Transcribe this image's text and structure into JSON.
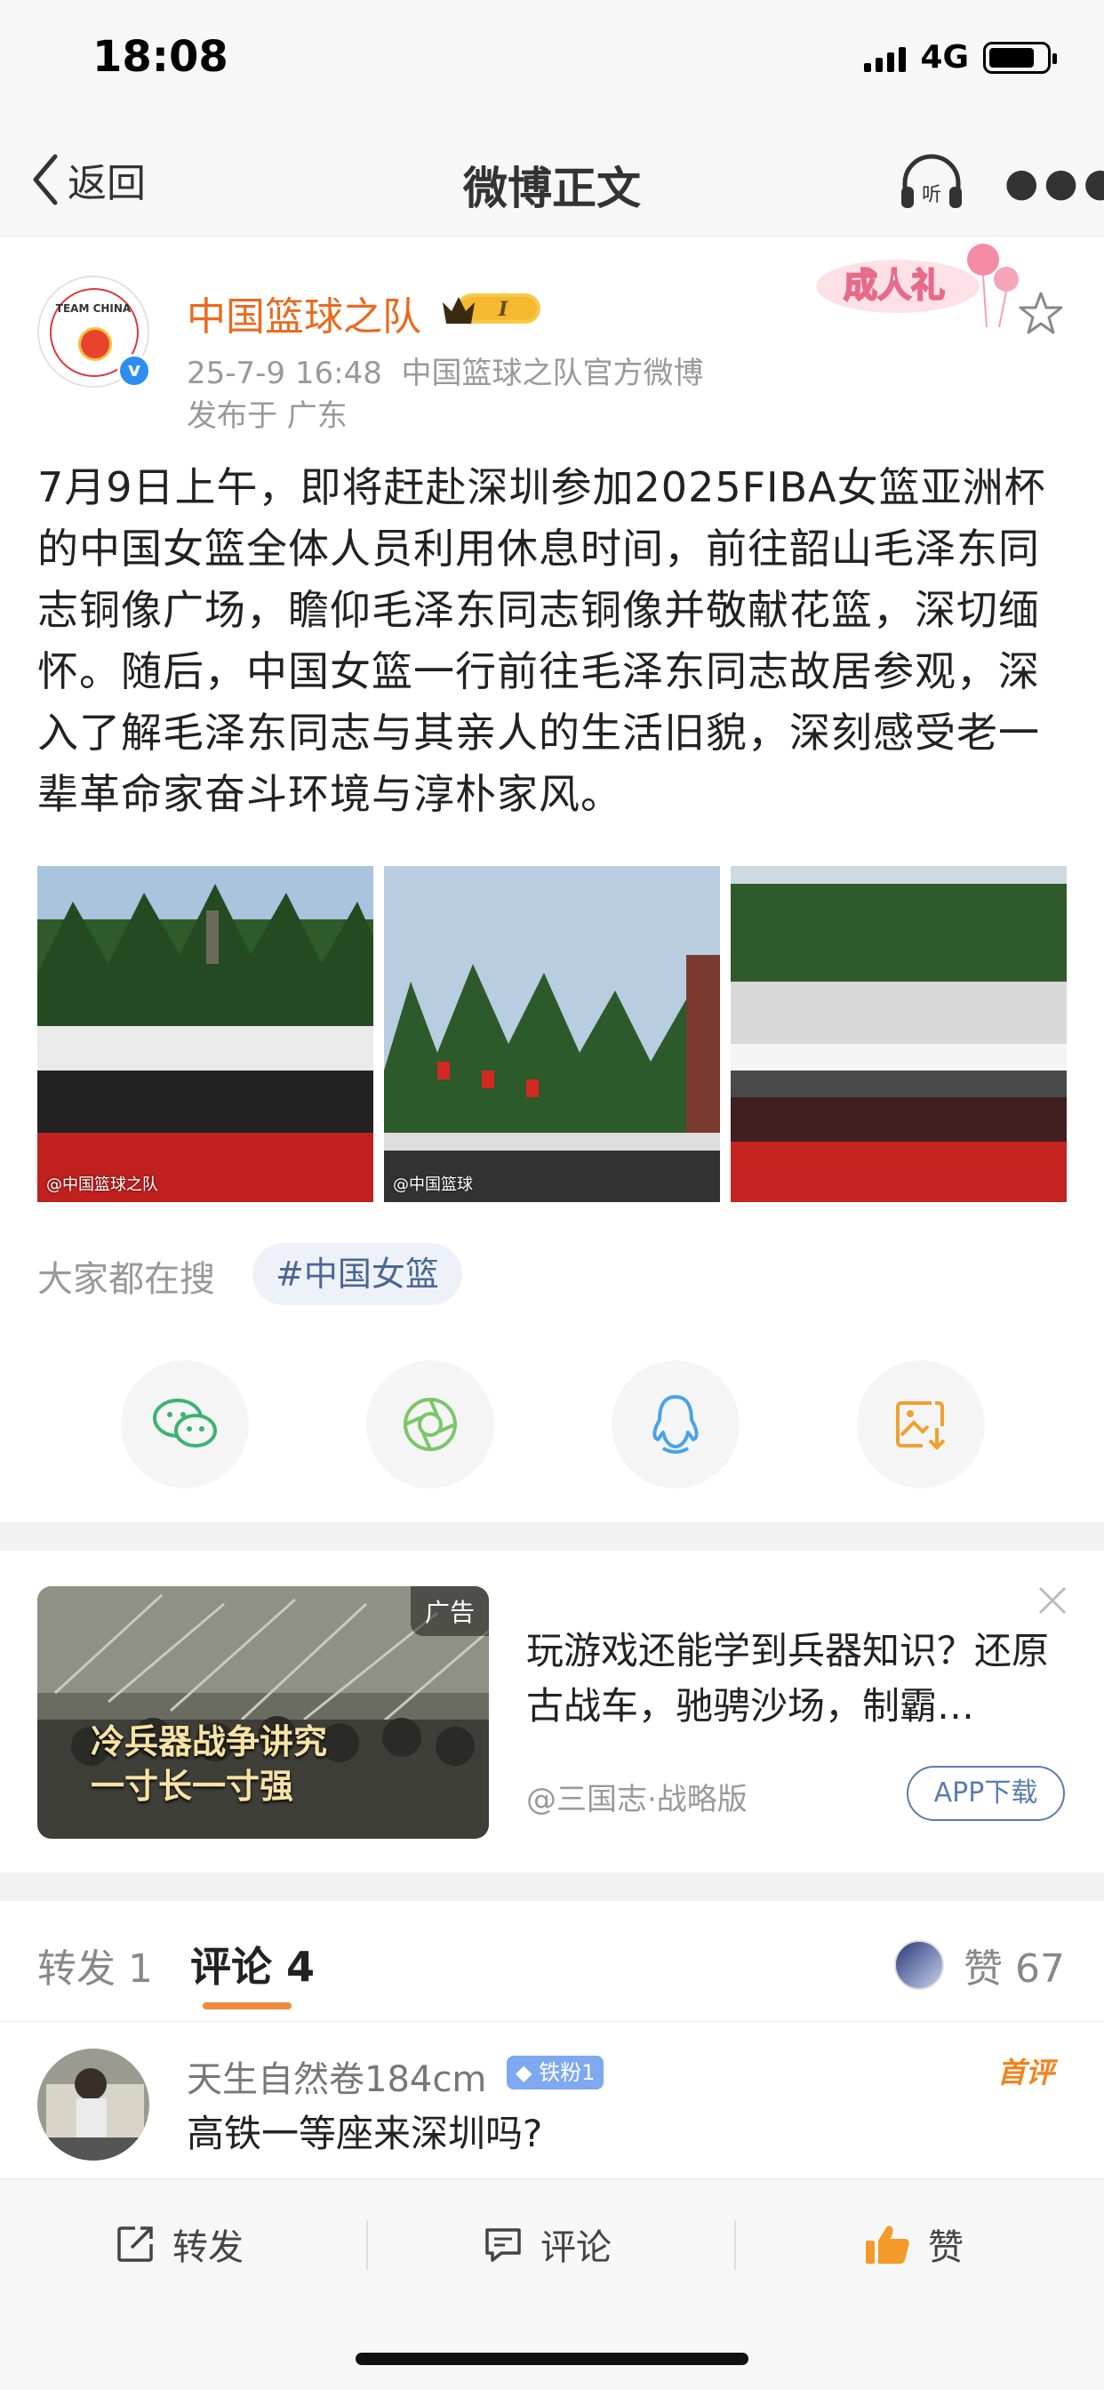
{
  "status_bar": {
    "time": "18:08",
    "network": "4G",
    "battery_level": 0.8
  },
  "nav": {
    "back_label": "返回",
    "title": "微博正文",
    "listen_label": "听"
  },
  "post": {
    "author": "中国篮球之队",
    "avatar_text": "TEAM CHINA",
    "level_badge": "I",
    "timestamp": "25-7-9 16:48",
    "source": "中国篮球之队官方微博",
    "location": "发布于 广东",
    "ceremony_badge": "成人礼",
    "text": "7月9日上午，即将赶赴深圳参加2025FIBA女篮亚洲杯的中国女篮全体人员利用休息时间，前往韶山毛泽东同志铜像广场，瞻仰毛泽东同志铜像并敬献花篮，深切缅怀。随后，中国女篮一行前往毛泽东同志故居参观，深入了解毛泽东同志与其亲人的生活旧貌，深刻感受老一辈革命家奋斗环境与淳朴家风。",
    "image_watermarks": [
      "@中国篮球之队",
      "@中国篮球",
      ""
    ]
  },
  "search": {
    "label": "大家都在搜",
    "tag": "#中国女篮"
  },
  "share_icons": [
    "wechat-icon",
    "moments-icon",
    "qq-icon",
    "save-image-icon"
  ],
  "ad": {
    "tag": "广告",
    "caption_line1": "冷兵器战争讲究",
    "caption_line2": "一寸长一寸强",
    "title": "玩游戏还能学到兵器知识？还原古战车，驰骋沙场，制霸…",
    "source": "@三国志·战略版",
    "app_button": "APP下载"
  },
  "tabs": {
    "forward": "转发 1",
    "comments": "评论 4",
    "likes": "赞 67"
  },
  "comment": {
    "name": "天生自然卷184cm",
    "fan_badge": "铁粉1",
    "first_badge": "首评",
    "text": "高铁一等座来深圳吗?"
  },
  "bottom_bar": {
    "forward": "转发",
    "comment": "评论",
    "like": "赞"
  },
  "colors": {
    "accent_orange": "#e86b1e",
    "link_blue": "#4a6795",
    "like_orange": "#f39a2b"
  }
}
